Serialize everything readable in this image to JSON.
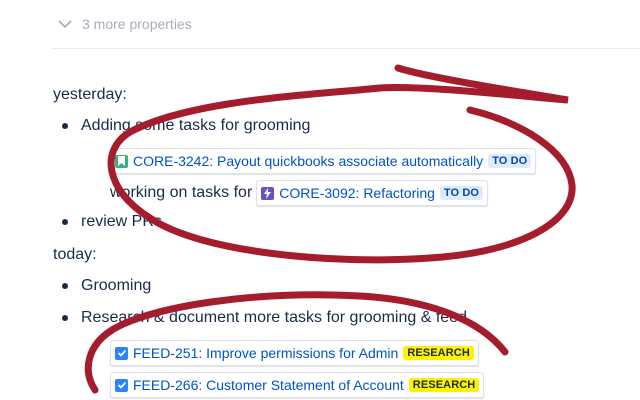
{
  "properties_toggle": {
    "label": "3 more properties"
  },
  "sections": [
    {
      "heading": "yesterday:",
      "bullets": [
        {
          "text": "Adding some tasks for grooming"
        },
        {
          "text": "review PRs"
        }
      ]
    },
    {
      "heading": "today:",
      "bullets": [
        {
          "text": "Grooming"
        },
        {
          "text": "Research & document more tasks for grooming & feed"
        }
      ]
    }
  ],
  "issues": {
    "core3242": {
      "key_title": "CORE-3242: Payout quickbooks associate automatically",
      "status": "TO DO",
      "type_icon": "story-icon",
      "type_color": "#36b37e"
    },
    "core3092": {
      "prefix": "working on tasks for",
      "key_title": "CORE-3092: Refactoring",
      "status": "TO DO",
      "type_icon": "epic-icon",
      "type_color": "#6554c0"
    },
    "feed251": {
      "key_title": "FEED-251: Improve permissions for Admin",
      "status": "RESEARCH",
      "type_icon": "task-icon",
      "type_color": "#2684ff"
    },
    "feed266": {
      "key_title": "FEED-266: Customer Statement of Account",
      "status": "RESEARCH",
      "type_icon": "task-icon",
      "type_color": "#2684ff"
    }
  },
  "colors": {
    "link": "#0052cc",
    "text": "#172b4d",
    "annotation_stroke": "#a51d2d"
  }
}
